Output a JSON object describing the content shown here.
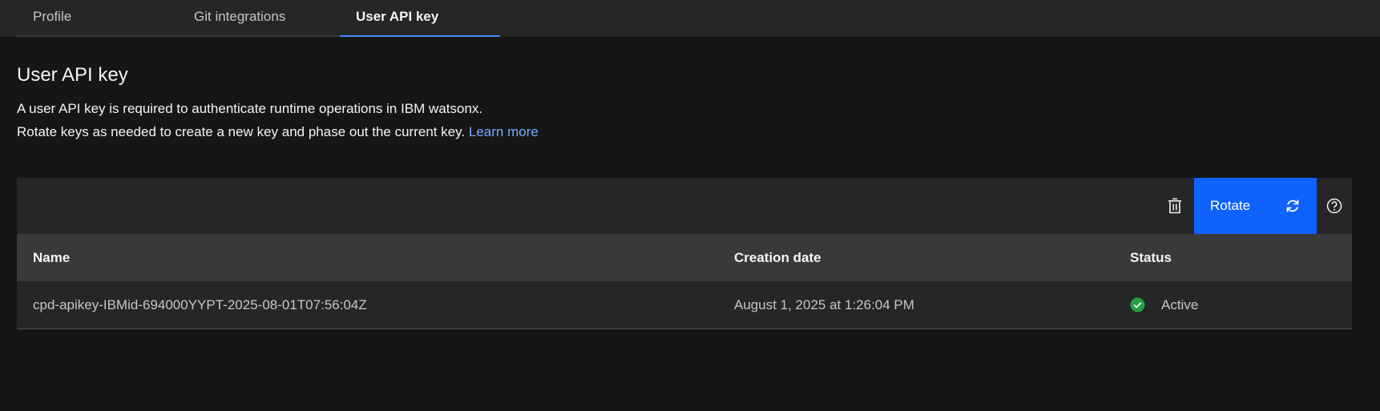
{
  "tabs": [
    {
      "label": "Profile",
      "active": false
    },
    {
      "label": "Git integrations",
      "active": false
    },
    {
      "label": "User API key",
      "active": true
    }
  ],
  "page": {
    "title": "User API key",
    "description_line1": "A user API key is required to authenticate runtime operations in IBM watsonx.",
    "description_line2": "Rotate keys as needed to create a new key and phase out the current key.",
    "learn_more": "Learn more"
  },
  "toolbar": {
    "delete_icon": "trash-icon",
    "rotate_label": "Rotate",
    "rotate_icon": "rotate-icon",
    "help_icon": "help-icon"
  },
  "table": {
    "headers": {
      "name": "Name",
      "creation_date": "Creation date",
      "status": "Status"
    },
    "rows": [
      {
        "name": "cpd-apikey-IBMid-694000YYPT-2025-08-01T07:56:04Z",
        "creation_date": "August 1, 2025 at 1:26:04 PM",
        "status": "Active"
      }
    ]
  },
  "colors": {
    "accent": "#0f62fe",
    "tab_active_underline": "#4589ff",
    "link": "#78a9ff",
    "status_active": "#24a148"
  }
}
